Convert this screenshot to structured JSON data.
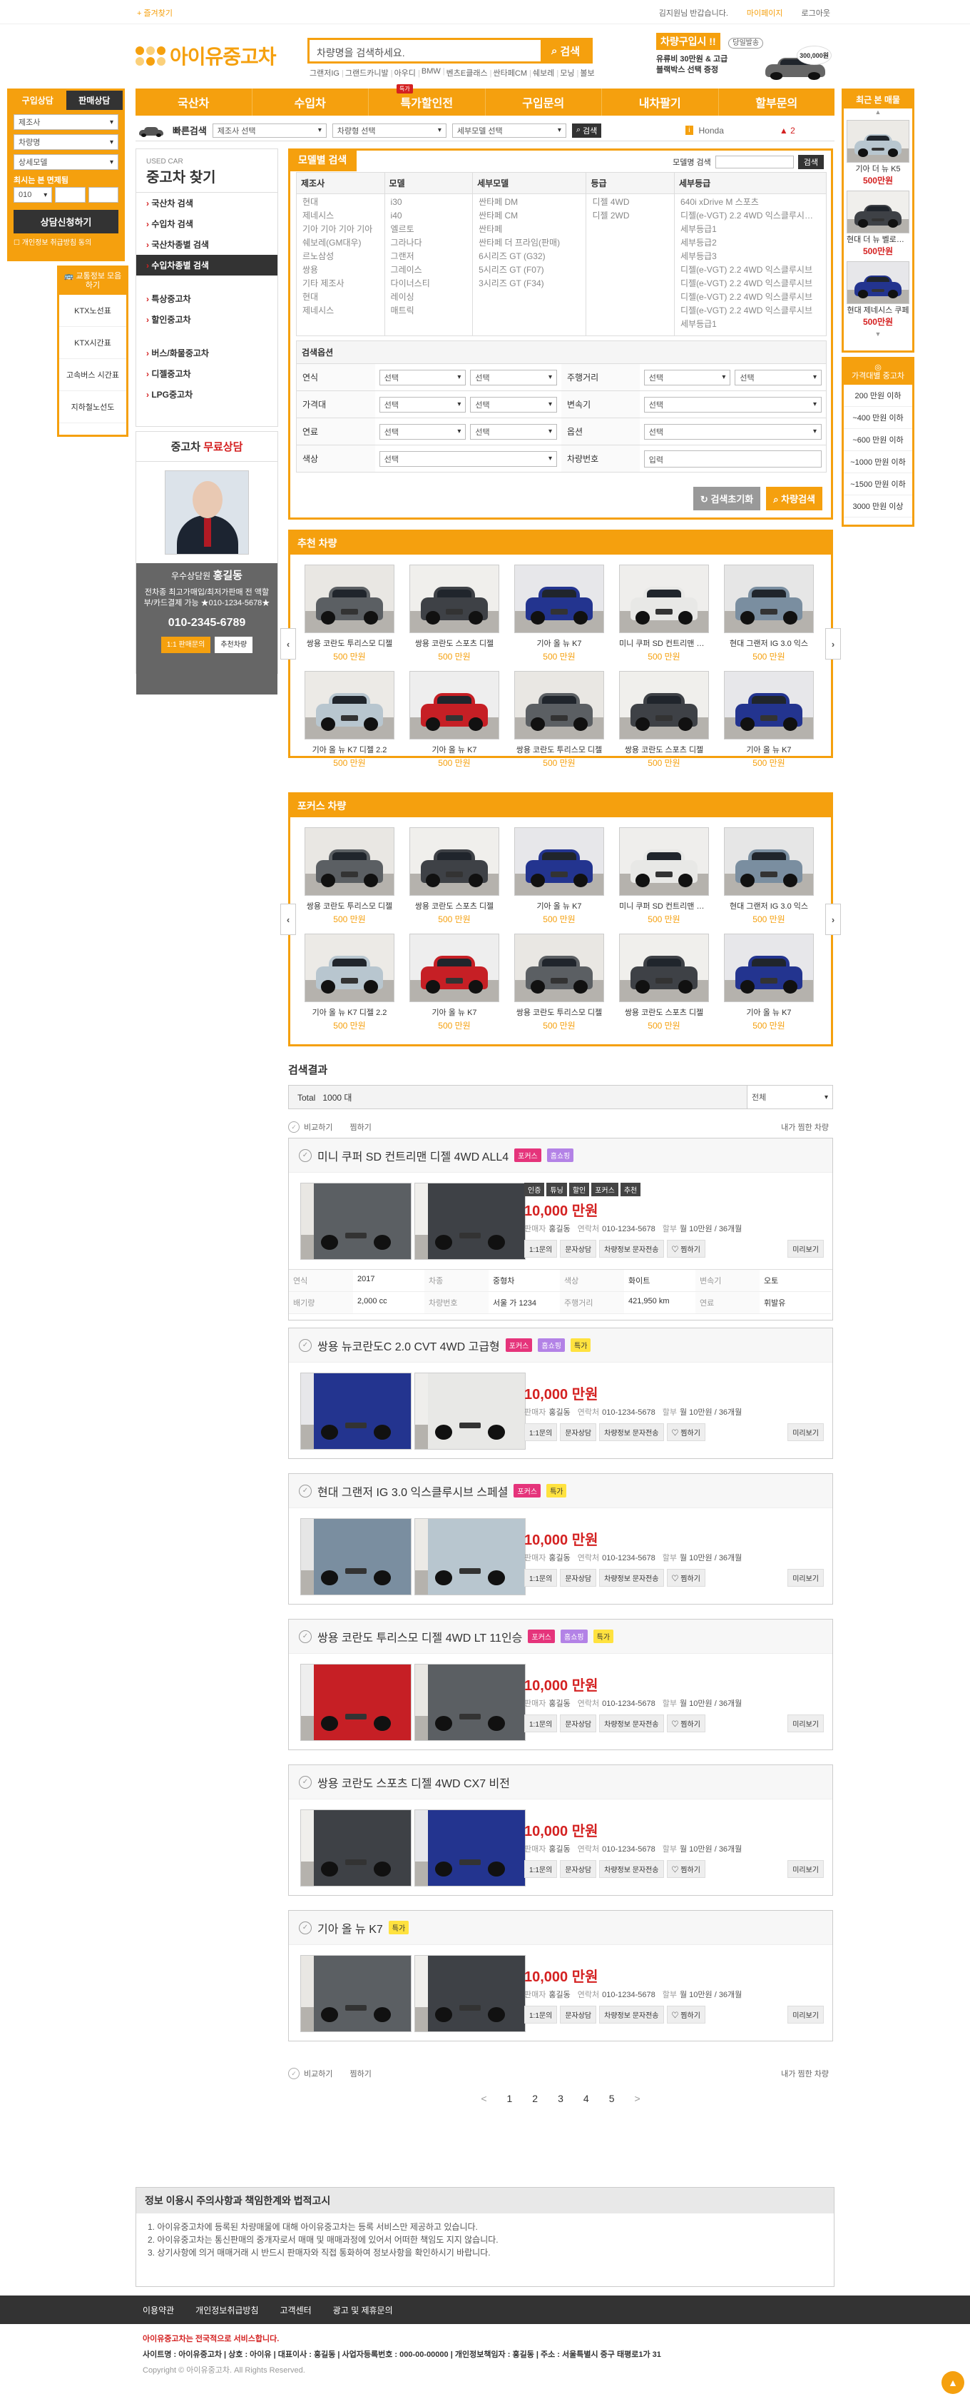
{
  "top": {
    "favorite": "+ 즐겨찾기",
    "greeting": "김지원님 반갑습니다.",
    "mypage": "마이페이지",
    "logout": "로그아웃"
  },
  "logo": "아이유중고차",
  "search": {
    "placeholder": "차량명을 검색하세요.",
    "button": "검색"
  },
  "keywords": [
    "그랜저IG",
    "그랜드카니발",
    "아우디",
    "BMW",
    "벤츠E클래스",
    "싼타페CM",
    "쉐보레",
    "모닝",
    "볼보"
  ],
  "promo": {
    "title": "차량구입시 !!",
    "badge": "당일발송",
    "line1": "유류비 30만원 & 고급",
    "line2": "블랙박스 선택 증정",
    "amount": "300,000원"
  },
  "gnb": [
    "국산차",
    "수입차",
    "특가할인전",
    "구입문의",
    "내차팔기",
    "할부문의"
  ],
  "gnb_badge": "특가",
  "quick": {
    "label": "빠른검색",
    "s1": "제조사 선택",
    "s2": "차량형 선택",
    "s3": "세부모델 선택",
    "btn": "검색",
    "recent_model": "Honda",
    "recent_count": "2"
  },
  "leftq": {
    "tab1": "구입상담",
    "tab2": "판매상담",
    "s1": "제조사",
    "s2": "차량명",
    "s3": "상세모델",
    "price_label": "최시는 본 면제됨",
    "price_sel": "010",
    "submit": "상담신청하기",
    "agree": "개인정보 취급방침 동의"
  },
  "leftinfo": {
    "title": "교통정보 모음하기",
    "items": [
      "KTX노선표",
      "KTX시간표",
      "고속버스 시간표",
      "지하철노선도"
    ]
  },
  "lnb": {
    "sub": "USED CAR",
    "title": "중고차 찾기",
    "g1": [
      "국산차 검색",
      "수입차 검색",
      "국산차종별 검색",
      "수입차종별 검색"
    ],
    "g2": [
      "특상중고차",
      "할인중고차"
    ],
    "g3": [
      "버스/화물중고차",
      "디젤중고차",
      "LPG중고차"
    ]
  },
  "consult": {
    "title1": "중고차 ",
    "title2": "무료상담",
    "role": "우수상담원",
    "name": "홍길동",
    "desc": "전차종 최고가매입/최저가판매 전 액할부/카드결제 가능 ★010-1234-5678★",
    "tel": "010-2345-6789",
    "b1": "1:1 판매문의",
    "b2": "추천차량"
  },
  "modelsearch": {
    "tab": "모델별 검색",
    "search_label": "모델명 검색",
    "search_btn": "검색",
    "cols": [
      {
        "h": "제조사",
        "v": [
          "현대",
          "제네시스",
          "기아 기아 기아 기아",
          "쉐보레(GM대우)",
          "르노삼성",
          "쌍용",
          "기타 제조사",
          "현대",
          "제네시스"
        ]
      },
      {
        "h": "모델",
        "v": [
          "i30",
          "i40",
          "엘르토",
          "그라나다",
          "그랜저",
          "그레이스",
          "다이너스티",
          "레이싱",
          "매트릭"
        ]
      },
      {
        "h": "세부모델",
        "v": [
          "싼타페 DM",
          "싼타페 CM",
          "싼타페",
          "싼타페 더 프라임(판매)",
          "6시리즈 GT (G32)",
          "5시리즈 GT (F07)",
          "3시리즈 GT (F34)"
        ]
      },
      {
        "h": "등급",
        "v": [
          "디젤 4WD",
          "디젤 2WD"
        ]
      },
      {
        "h": "세부등급",
        "v": [
          "640i xDrive M 스포츠",
          "디젤(e-VGT) 2.2 4WD 익스클루시브 (선 다",
          "세부등급1",
          "세부등급2",
          "세부등급3",
          "디젤(e-VGT) 2.2 4WD 익스클루시브",
          "디젤(e-VGT) 2.2 4WD 익스클루시브",
          "디젤(e-VGT) 2.2 4WD 익스클루시브",
          "디젤(e-VGT) 2.2 4WD 익스클루시브",
          "세부등급1"
        ]
      }
    ],
    "opt_title": "검색옵션",
    "rows": [
      {
        "k1": "연식",
        "k2": "주행거리"
      },
      {
        "k1": "가격대",
        "k2": "변속기"
      },
      {
        "k1": "연료",
        "k2": "옵션"
      },
      {
        "k1": "색상",
        "k2": "차량번호"
      }
    ],
    "sel": "선택",
    "input": "입력",
    "reset": "검색초기화",
    "submit": "차량검색"
  },
  "rec": {
    "title": "추천 차량",
    "items": [
      {
        "n": "쌍용 코란도 투리스모 디젤",
        "p": "500 만원"
      },
      {
        "n": "쌍용 코란도 스포츠 디젤",
        "p": "500 만원"
      },
      {
        "n": "기아 올 뉴 K7",
        "p": "500 만원"
      },
      {
        "n": "미니 쿠퍼 SD 컨트리맨 디젤",
        "p": "500 만원"
      },
      {
        "n": "현대 그랜저 IG 3.0 익스",
        "p": "500 만원"
      },
      {
        "n": "기아 올 뉴 K7 디젤 2.2",
        "p": "500 만원"
      },
      {
        "n": "기아 올 뉴 K7",
        "p": "500 만원"
      },
      {
        "n": "쌍용 코란도 투리스모 디젤",
        "p": "500 만원"
      },
      {
        "n": "쌍용 코란도 스포츠 디젤",
        "p": "500 만원"
      },
      {
        "n": "기아 올 뉴 K7",
        "p": "500 만원"
      }
    ]
  },
  "focus": {
    "title": "포커스 차량",
    "items": [
      {
        "n": "쌍용 코란도 투리스모 디젤",
        "p": "500 만원"
      },
      {
        "n": "쌍용 코란도 스포츠 디젤",
        "p": "500 만원"
      },
      {
        "n": "기아 올 뉴 K7",
        "p": "500 만원"
      },
      {
        "n": "미니 쿠퍼 SD 컨트리맨 디젤",
        "p": "500 만원"
      },
      {
        "n": "현대 그랜저 IG 3.0 익스",
        "p": "500 만원"
      },
      {
        "n": "기아 올 뉴 K7 디젤 2.2",
        "p": "500 만원"
      },
      {
        "n": "기아 올 뉴 K7",
        "p": "500 만원"
      },
      {
        "n": "쌍용 코란도 투리스모 디젤",
        "p": "500 만원"
      },
      {
        "n": "쌍용 코란도 스포츠 디젤",
        "p": "500 만원"
      },
      {
        "n": "기아 올 뉴 K7",
        "p": "500 만원"
      }
    ]
  },
  "results": {
    "title": "검색결과",
    "total_label": "Total",
    "total": "1000 대",
    "sort": "전체",
    "compare": "비교하기",
    "wish": "찜하기",
    "my": "내가 찜한 차량"
  },
  "listings": [
    {
      "name": "미니 쿠퍼 SD 컨트리맨 디젤 4WD ALL4",
      "badges": [
        "포커스",
        "홈쇼핑"
      ],
      "tags": [
        "인증",
        "튜닝",
        "할인",
        "포커스",
        "추천"
      ],
      "price": "10,000 만원",
      "seller": "홍길동",
      "tel": "010-1234-5678",
      "loan": "월 10만원 / 36개월",
      "spec": [
        [
          "연식",
          "2017"
        ],
        [
          "차종",
          "중형차"
        ],
        [
          "색상",
          "화이트"
        ],
        [
          "변속기",
          "오토"
        ],
        [
          "배기량",
          "2,000 cc"
        ],
        [
          "차량번호",
          "서울 가 1234"
        ],
        [
          "주행거리",
          "421,950 km"
        ],
        [
          "연료",
          "휘발유"
        ]
      ]
    },
    {
      "name": "쌍용 뉴코란도C 2.0 CVT 4WD 고급형",
      "badges": [
        "포커스",
        "홈쇼핑",
        "특가"
      ],
      "tags": [],
      "price": "10,000 만원",
      "seller": "홍길동",
      "tel": "010-1234-5678",
      "loan": "월 10만원 / 36개월"
    },
    {
      "name": "현대 그랜저 IG 3.0 익스클루시브 스페셜",
      "badges": [
        "포커스",
        "특가"
      ],
      "tags": [],
      "price": "10,000 만원",
      "seller": "홍길동",
      "tel": "010-1234-5678",
      "loan": "월 10만원 / 36개월"
    },
    {
      "name": "쌍용 코란도 투리스모 디젤 4WD LT 11인승",
      "badges": [
        "포커스",
        "홈쇼핑",
        "특가"
      ],
      "tags": [],
      "price": "10,000 만원",
      "seller": "홍길동",
      "tel": "010-1234-5678",
      "loan": "월 10만원 / 36개월"
    },
    {
      "name": "쌍용 코란도 스포츠 디젤 4WD CX7 비전",
      "badges": [],
      "tags": [],
      "price": "10,000 만원",
      "seller": "홍길동",
      "tel": "010-1234-5678",
      "loan": "월 10만원 / 36개월"
    },
    {
      "name": "기아 올 뉴 K7",
      "badges": [
        "특가"
      ],
      "tags": [],
      "price": "10,000 만원",
      "seller": "홍길동",
      "tel": "010-1234-5678",
      "loan": "월 10만원 / 36개월"
    }
  ],
  "listing_labels": {
    "seller": "판매자",
    "tel": "연락처",
    "loan": "할부",
    "b1": "1:1문의",
    "b2": "문자상담",
    "b3": "차량정보 문자전송",
    "b4": "찜하기",
    "b5": "미리보기"
  },
  "pager": [
    "<",
    "1",
    "2",
    "3",
    "4",
    "5",
    ">"
  ],
  "notice": {
    "title": "정보 이용시 주의사항과 책임한계와 법적고시",
    "lines": [
      "1. 아이유중고차에 등록된 차량매물에 대해 아이유중고차는 등록 서비스만 제공하고 있습니다.",
      "2. 아이유중고차는 통신판매의 중개자로서 매매 및 매매과정에 있어서 어떠한 책임도 지지 않습니다.",
      "3. 상기사항에 의거 매매거래 시 반드시 판매자와 직접 통화하여 정보사항을 확인하시기 바랍니다."
    ]
  },
  "footnav": [
    "이용약관",
    "개인정보취급방침",
    "고객센터",
    "광고 및 제휴문의"
  ],
  "foot": {
    "h": "아이유중고차는 전국적으로 서비스합니다.",
    "l1": "사이트명 : 아이유중고차 | 상호 : 아이유 | 대표이사 : 홍길동 | 사업자등록번호 : 000-00-00000 | 개인정보책임자 : 홍길동 | 주소 : 서울특별시 중구 태평로1가 31",
    "l2": "Copyright © 아이유중고차. All Rights Reserved."
  },
  "recent": {
    "title": "최근 본 매물",
    "items": [
      {
        "n": "기아 더 뉴 K5",
        "p": "500만원"
      },
      {
        "n": "현대 더 뉴 벨로스터",
        "p": "500만원"
      },
      {
        "n": "현대 제네시스 쿠페",
        "p": "500만원"
      }
    ]
  },
  "byprice": {
    "title": "가격대별 중고차",
    "items": [
      "200 만원 이하",
      "~400 만원 이하",
      "~600 만원 이하",
      "~1000 만원 이하",
      "~1500 만원 이하",
      "3000 만원 이상"
    ]
  },
  "colors": {
    "accent": "#f5a00e",
    "price": "#d42121"
  }
}
